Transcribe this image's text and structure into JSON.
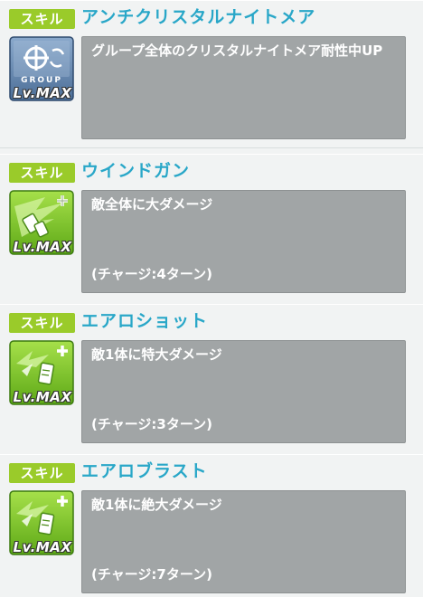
{
  "skills": [
    {
      "badge": "スキル",
      "title": "アンチクリスタルナイトメア",
      "icon": "group-support-icon",
      "icon_caption": "GROUP",
      "level": "Lv.MAX",
      "description": "グループ全体のクリスタルナイトメア耐性中UP",
      "charge": ""
    },
    {
      "badge": "スキル",
      "title": "ウインドガン",
      "icon": "wind-attack-icon",
      "level": "Lv.MAX",
      "description": "敵全体に大ダメージ",
      "charge": "(チャージ:4ターン)"
    },
    {
      "badge": "スキル",
      "title": "エアロショット",
      "icon": "wind-attack-icon",
      "level": "Lv.MAX",
      "description": "敵1体に特大ダメージ",
      "charge": "(チャージ:3ターン)"
    },
    {
      "badge": "スキル",
      "title": "エアロブラスト",
      "icon": "wind-attack-icon",
      "level": "Lv.MAX",
      "description": "敵1体に絶大ダメージ",
      "charge": "(チャージ:7ターン)"
    }
  ],
  "colors": {
    "badge_bg": "#9acb2a",
    "title": "#29a7c8",
    "desc_bg": "#a1a5a6",
    "wind_icon": "#7fc623",
    "group_icon": "#6f8fb3"
  }
}
